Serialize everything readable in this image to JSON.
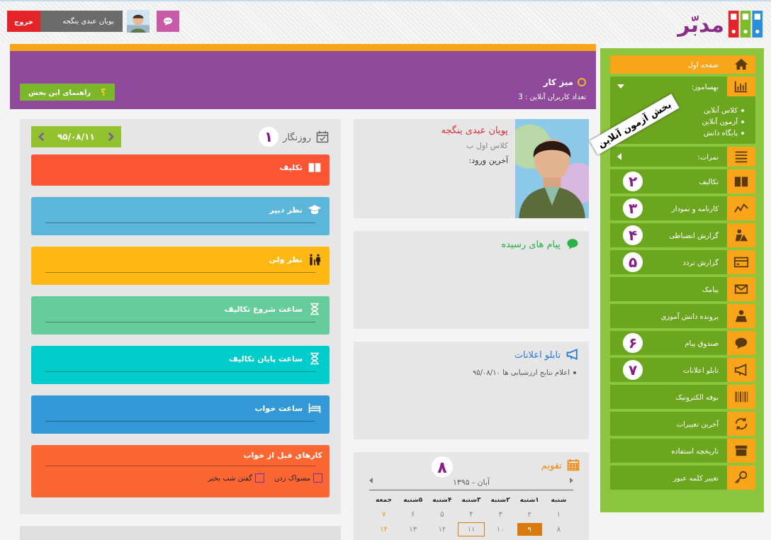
{
  "topbar": {
    "logout": "خروج",
    "user_name": "پویان عبدی ینگجه",
    "logo": "مدبّر"
  },
  "header": {
    "title": "میز کار",
    "online_users": "تعداد کاربران آنلاین : 3",
    "help_icon": "؟",
    "help_button": "راهنمای این بخش"
  },
  "journal": {
    "title": "روزنگار",
    "badge": "۱",
    "date": "۹۵/۰۸/۱۱",
    "cards": [
      {
        "kind": "plain",
        "title": "تکلیف",
        "color": "#fb5533"
      },
      {
        "kind": "lined",
        "title": "نظر دبیر",
        "color": "#5cb6da"
      },
      {
        "kind": "lined",
        "title": "نظر ولی",
        "color": "#fdb813"
      },
      {
        "kind": "lined",
        "title": "ساعت شروع تکالیف",
        "color": "#66cc99"
      },
      {
        "kind": "lined",
        "title": "ساعت پایان تکالیف",
        "color": "#00cccc"
      },
      {
        "kind": "lined",
        "title": "ساعت خواب",
        "color": "#3399d6"
      },
      {
        "kind": "checklist",
        "title": "کارهای قبل از خواب",
        "color": "#fb6633",
        "tasks": [
          {
            "label": "مسواک زدن",
            "checked": false
          },
          {
            "label": "گفتن شب بخیر",
            "checked": false
          }
        ]
      }
    ]
  },
  "profile": {
    "name": "پویان عبدی ینگجه",
    "class": "کلاس اول ب",
    "last_login": "آخرین ورود:"
  },
  "messages": {
    "title": "پیام های رسیده"
  },
  "notices": {
    "title": "تابلو اعلانات",
    "items": [
      {
        "text": "اعلام نتایج ارزشیابی ها",
        "date": "۹۵/۰۸/۱۰"
      }
    ]
  },
  "calendar": {
    "title": "تقویم",
    "month": "آبان - ۱۳۹۵",
    "badge": "۸",
    "weekdays": [
      "شنبه",
      "۱شنبه",
      "۲شنبه",
      "۳شنبه",
      "۴شنبه",
      "۵شنبه",
      "جمعه"
    ],
    "days": [
      {
        "label": "۱",
        "selected": false,
        "today": false,
        "holiday": false
      },
      {
        "label": "۲",
        "selected": false,
        "today": false,
        "holiday": false
      },
      {
        "label": "۳",
        "selected": false,
        "today": false,
        "holiday": false
      },
      {
        "label": "۴",
        "selected": false,
        "today": false,
        "holiday": false
      },
      {
        "label": "۵",
        "selected": false,
        "today": false,
        "holiday": false
      },
      {
        "label": "۶",
        "selected": false,
        "today": false,
        "holiday": false
      },
      {
        "label": "۷",
        "selected": false,
        "today": false,
        "holiday": true
      },
      {
        "label": "۸",
        "selected": false,
        "today": false,
        "holiday": false
      },
      {
        "label": "۹",
        "selected": true,
        "today": false,
        "holiday": false
      },
      {
        "label": "۱۰",
        "selected": false,
        "today": false,
        "holiday": false
      },
      {
        "label": "۱۱",
        "selected": false,
        "today": true,
        "holiday": false
      },
      {
        "label": "۱۲",
        "selected": false,
        "today": false,
        "holiday": false
      },
      {
        "label": "۱۳",
        "selected": false,
        "today": false,
        "holiday": false
      },
      {
        "label": "۱۴",
        "selected": false,
        "today": false,
        "holiday": true
      }
    ]
  },
  "sidebar": {
    "sticker": "بخش آزمون آنلاین",
    "items": [
      {
        "kind": "link",
        "label": "صفحه اول",
        "selected": true
      },
      {
        "kind": "group",
        "label": "بهساموز:",
        "selected": false,
        "expanded": true,
        "children": [
          "کلاس آنلاین",
          "آزمون آنلاین",
          "پایگاه دانش"
        ]
      },
      {
        "kind": "group",
        "label": "نمرات:",
        "selected": false,
        "expanded": false
      },
      {
        "kind": "link",
        "label": "تکالیف",
        "selected": false,
        "badge": "۲"
      },
      {
        "kind": "link",
        "label": "کارنامه و نمودار",
        "selected": false,
        "badge": "۳"
      },
      {
        "kind": "link",
        "label": "گزارش انضباطی",
        "selected": false,
        "badge": "۴"
      },
      {
        "kind": "link",
        "label": "گزارش تردد",
        "selected": false,
        "badge": "۵"
      },
      {
        "kind": "link",
        "label": "پیامک",
        "selected": false
      },
      {
        "kind": "link",
        "label": "پرونده دانش آموزی",
        "selected": false
      },
      {
        "kind": "link",
        "label": "صندوق پیام",
        "selected": false,
        "badge": "۶"
      },
      {
        "kind": "link",
        "label": "تابلو اعلانات",
        "selected": false,
        "badge": "۷"
      },
      {
        "kind": "link",
        "label": "بوفه الکترونیک",
        "selected": false
      },
      {
        "kind": "link",
        "label": "آخرین تغییرات",
        "selected": false
      },
      {
        "kind": "link",
        "label": "تاریخچه استفاده",
        "selected": false
      },
      {
        "kind": "link",
        "label": "تغییر کلمه عبور",
        "selected": false
      }
    ]
  }
}
